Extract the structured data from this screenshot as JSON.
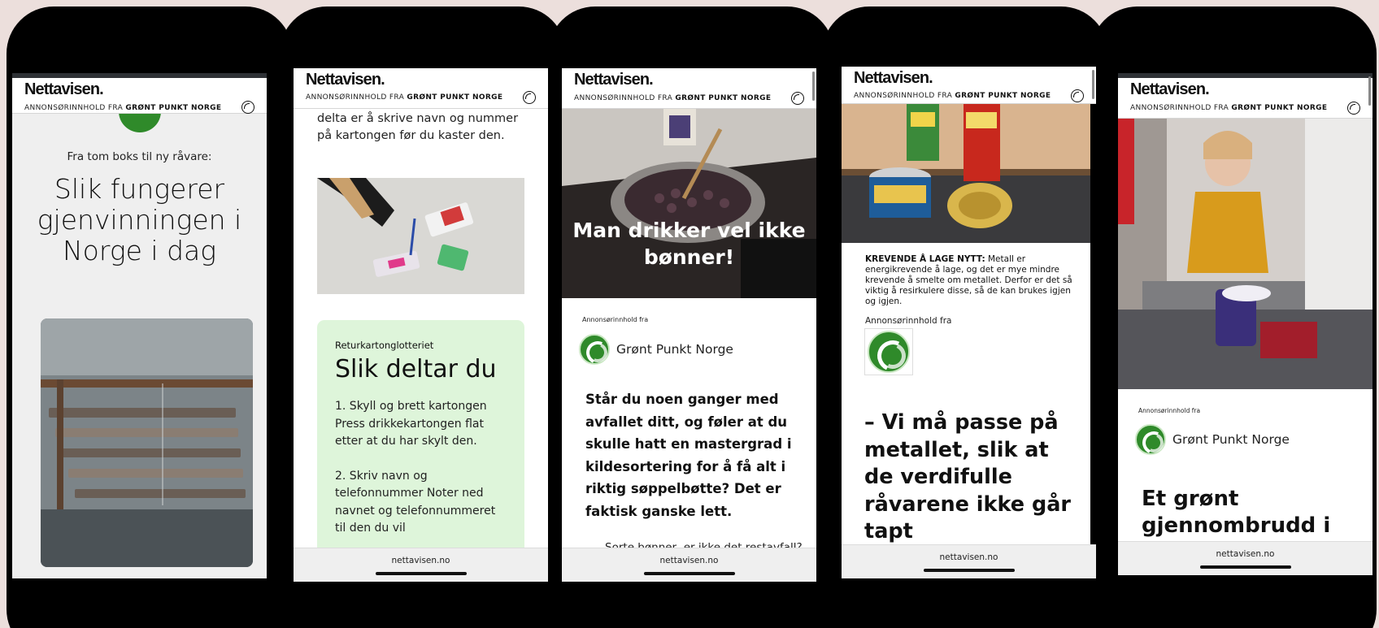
{
  "site": {
    "logo": "Nettavisen.",
    "sponsor_prefix": "ANNONSØRINNHOLD FRA",
    "sponsor_name": "GRØNT PUNKT NORGE",
    "footer_url": "nettavisen.no"
  },
  "advertiser": {
    "label": "Annonsørinnhold fra",
    "name": "Grønt Punkt Norge"
  },
  "phones": [
    {
      "kicker": "Fra tom boks til ny råvare:",
      "title": "Slik fungerer gjenvinningen i Norge i dag"
    },
    {
      "text_top": "delta er å skrive navn og nummer på kartongen før du kaster den.",
      "box_eyebrow": "Returkartonglotteriet",
      "box_title": "Slik deltar du",
      "step1": "1. Skyll og brett kartongen Press drikkekartongen flat etter at du har skylt den.",
      "step2": "2. Skriv navn og telefonnummer Noter ned navnet og telefonnummeret til den du vil"
    },
    {
      "hero_title": "Man drikker vel ikke bønner!",
      "lead": "Står du noen ganger med avfallet ditt, og føler at du skulle hatt en mastergrad i kildesortering for å få alt i riktig søppelbøtte? Det er faktisk ganske lett.",
      "cut_text": "– Sorte bønner, er ikke det restavfall?"
    },
    {
      "caption_bold": "KREVENDE Å LAGE NYTT:",
      "caption_rest": "Metall er energikrevende å lage, og det er mye mindre krevende å smelte om metallet. Derfor er det så viktig å resirkulere disse, så de kan brukes igjen og igjen.",
      "quote": "– Vi må passe på metallet, slik at de verdifulle råvarene ikke går tapt"
    },
    {
      "headline": "Et grønt gjennombrudd i"
    }
  ],
  "icons": {
    "header_right": "circular-arrow-icon",
    "brand": "green-dot-recycle-icon"
  },
  "colors": {
    "page_bg": "#ecdfdc",
    "phone_frame": "#000000",
    "brand_green": "#2f8a2a",
    "box_green": "#def5da"
  }
}
